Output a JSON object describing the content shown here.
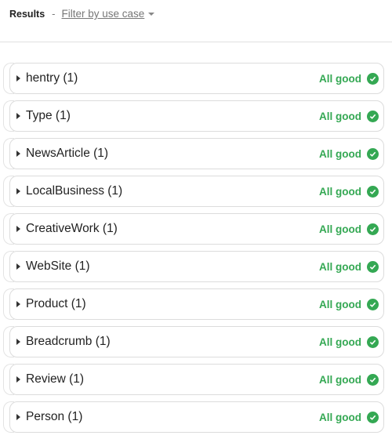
{
  "header": {
    "title": "Results",
    "separator": "-",
    "filter_label": "Filter by use case"
  },
  "colors": {
    "success": "#34a853"
  },
  "items": [
    {
      "label": "hentry (1)",
      "status": "All good",
      "icon": "check-circle-icon"
    },
    {
      "label": "Type (1)",
      "status": "All good",
      "icon": "check-circle-icon"
    },
    {
      "label": "NewsArticle (1)",
      "status": "All good",
      "icon": "check-circle-icon"
    },
    {
      "label": "LocalBusiness (1)",
      "status": "All good",
      "icon": "check-circle-icon"
    },
    {
      "label": "CreativeWork (1)",
      "status": "All good",
      "icon": "check-circle-icon"
    },
    {
      "label": "WebSite (1)",
      "status": "All good",
      "icon": "check-circle-icon"
    },
    {
      "label": "Product (1)",
      "status": "All good",
      "icon": "check-circle-icon"
    },
    {
      "label": "Breadcrumb (1)",
      "status": "All good",
      "icon": "check-circle-icon"
    },
    {
      "label": "Review (1)",
      "status": "All good",
      "icon": "check-circle-icon"
    },
    {
      "label": "Person (1)",
      "status": "All good",
      "icon": "check-circle-icon"
    }
  ]
}
